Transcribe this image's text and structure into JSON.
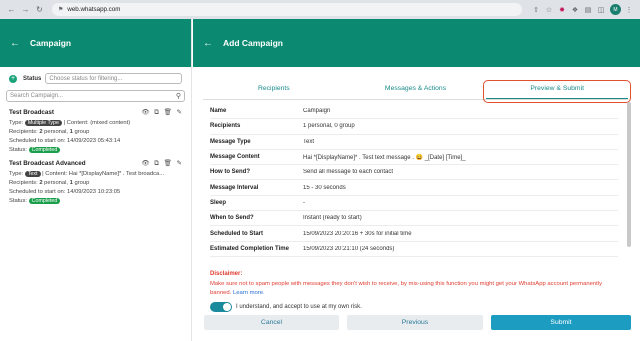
{
  "browser": {
    "url": "web.whatsapp.com",
    "profile_initials": "M"
  },
  "left": {
    "title": "Campaign",
    "status_label": "Status",
    "status_placeholder": "Choose status for filtering...",
    "search_placeholder": "Search Campaign...",
    "campaigns": [
      {
        "title": "Test Broadcast",
        "type_label": "Type:",
        "type_badge": "Multiple Type",
        "content": "| Content: (mixed content)",
        "recipients_prefix": "Recipients:",
        "personal_count": "2",
        "personal_label": "personal,",
        "group_count": "1",
        "group_label": "group",
        "scheduled": "Scheduled to start on: 14/09/2023 05:43:14",
        "status_label": "Status:",
        "status_badge": "Completed"
      },
      {
        "title": "Test Broadcast Advanced",
        "type_label": "Type:",
        "type_badge": "Text",
        "content": "| Content: Hai *[DisplayName]* . Test broadca...",
        "recipients_prefix": "Recipients:",
        "personal_count": "2",
        "personal_label": "personal,",
        "group_count": "1",
        "group_label": "group",
        "scheduled": "Scheduled to start on: 14/09/2023 10:23:05",
        "status_label": "Status:",
        "status_badge": "Completed"
      }
    ]
  },
  "right": {
    "title": "Add Campaign",
    "tabs": [
      "Recipients",
      "Messages & Actions",
      "Preview & Submit"
    ],
    "rows": [
      {
        "key": "Name",
        "value": "Campaign"
      },
      {
        "key": "Recipients",
        "value": "1 personal, 0 group"
      },
      {
        "key": "Message Type",
        "value": "Text"
      },
      {
        "key": "Message Content",
        "value": "Hai *[DisplayName]* . Test text message . 😀 _[Date] [Time]_"
      },
      {
        "key": "How to Send?",
        "value": "Send all message to each contact"
      },
      {
        "key": "Message Interval",
        "value": "15 - 30 seconds"
      },
      {
        "key": "Sleep",
        "value": "-"
      },
      {
        "key": "When to Send?",
        "value": "Instant (ready to start)"
      },
      {
        "key": "Scheduled to Start",
        "value": "15/09/2023 20:20:16 + 30s for initial time"
      },
      {
        "key": "Estimated Completion Time",
        "value": "15/09/2023 20:21:10 (24 seconds)"
      }
    ],
    "disclaimer_title": "Disclaimer:",
    "disclaimer_text": "Make sure not to spam people with messages they don't wish to receive, by mis-using this function you might get your WhatsApp account permanently banned.",
    "learn_more": "Learn more.",
    "accept_text": "I understand, and accept to use at my own risk.",
    "buttons": {
      "cancel": "Cancel",
      "previous": "Previous",
      "submit": "Submit"
    }
  },
  "colors": {
    "header": "#0b8a71",
    "accent": "#1a8a8a",
    "highlight": "#e0522e",
    "submit": "#1c9cc0"
  }
}
